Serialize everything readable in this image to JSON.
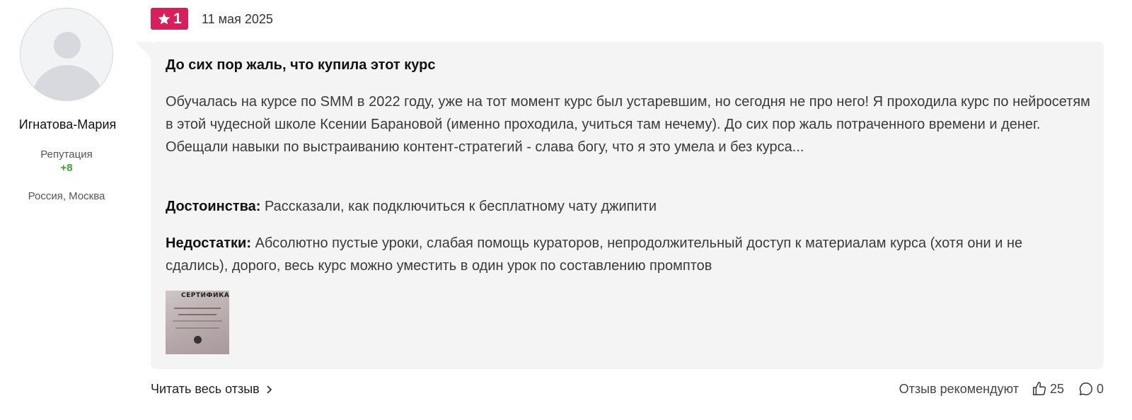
{
  "author": {
    "name": "Игнатова-Мария",
    "reputation_label": "Репутация",
    "reputation_value": "+8",
    "location": "Россия, Москва"
  },
  "review": {
    "rating": "1",
    "date": "11 мая 2025",
    "title": "До сих пор жаль, что купила этот курс",
    "text": "Обучалась на курсе по SMM в 2022 году, уже на тот момент курс был устаревшим, но сегодня не про него! Я проходила курс по нейросетям в этой чудесной школе Ксении Барановой (именно проходила, учиться там нечему). До сих пор жаль потраченного времени и денег. Обещали навыки по выстраиванию контент-стратегий - слава богу, что я это умела и без курса...",
    "pros_label": "Достоинства:",
    "pros": "Рассказали, как подключиться к бесплатному чату джипити",
    "cons_label": "Недостатки:",
    "cons": "Абсолютно пустые уроки, слабая помощь кураторов, непродолжительный доступ к материалам курса (хотя они и не сдались), дорого, весь курс можно уместить в один урок по составлению промптов",
    "attachment_caption": "СЕРТИФИКАТ"
  },
  "footer": {
    "read_more": "Читать весь отзыв",
    "recommend_label": "Отзыв рекомендуют",
    "likes": "25",
    "comments": "0"
  },
  "colors": {
    "badge": "#d81e5b",
    "reputation": "#3aa534",
    "card": "#f4f4f5"
  },
  "icons": [
    "star-icon",
    "chevron-right-icon",
    "thumbs-up-icon",
    "comment-icon"
  ]
}
